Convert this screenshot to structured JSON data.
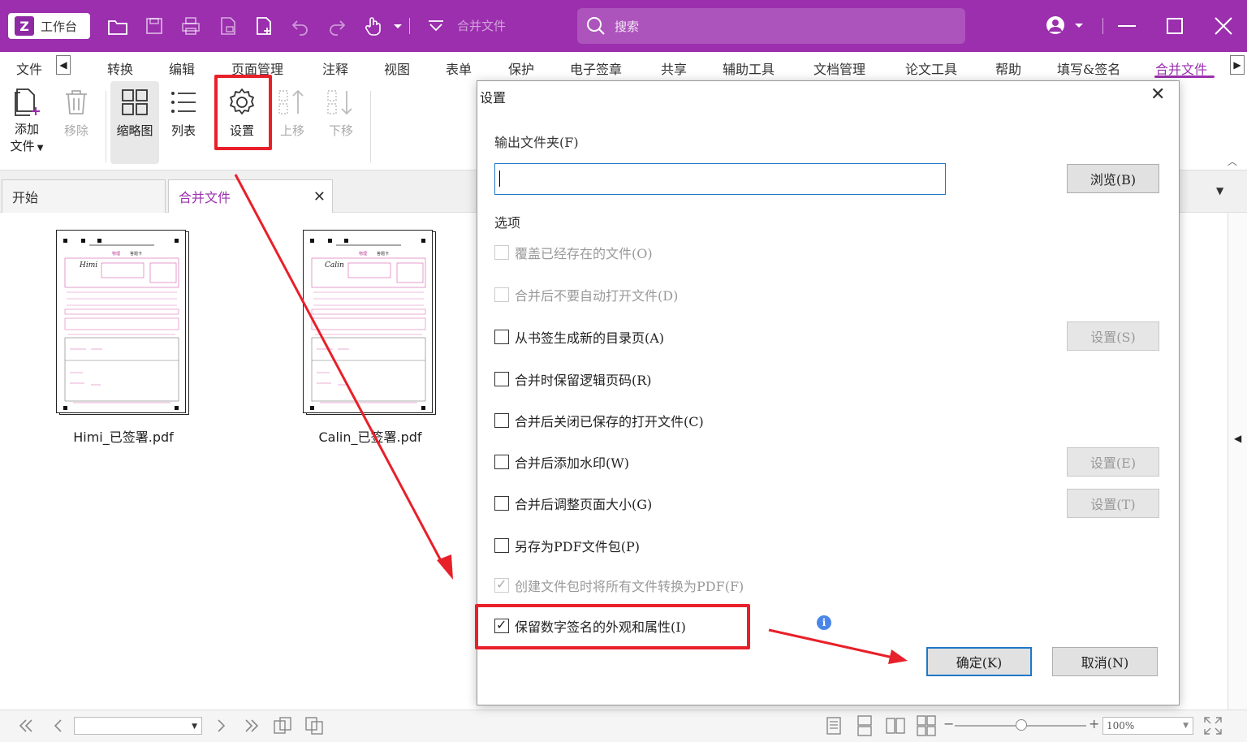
{
  "titlebar": {
    "home_label": "工作台",
    "doc_title": "合并文件",
    "search_placeholder": "搜索"
  },
  "menu": {
    "items": [
      "文件",
      "转换",
      "编辑",
      "页面管理",
      "注释",
      "视图",
      "表单",
      "保护",
      "电子签章",
      "共享",
      "辅助工具",
      "文档管理",
      "论文工具",
      "帮助",
      "填写&签名",
      "合并文件"
    ],
    "active": "合并文件"
  },
  "ribbon": {
    "add_file": "添加",
    "add_file_2": "文件",
    "remove": "移除",
    "thumbnail": "缩略图",
    "list": "列表",
    "settings": "设置",
    "move_up": "上移",
    "move_down": "下移"
  },
  "tabs": {
    "start": "开始",
    "merge": "合并文件"
  },
  "files": [
    {
      "name": "Himi_已签署.pdf",
      "signature": "Himi"
    },
    {
      "name": "Calin_已签署.pdf",
      "signature": "Calin"
    }
  ],
  "statusbar": {
    "zoom": "100%"
  },
  "dialog": {
    "title": "设置",
    "output_folder_label": "输出文件夹(F)",
    "output_folder_value": "",
    "browse": "浏览(B)",
    "options_label": "选项",
    "options": [
      {
        "label": "覆盖已经存在的文件(O)",
        "checked": false,
        "disabled": true
      },
      {
        "label": "合并后不要自动打开文件(D)",
        "checked": false,
        "disabled": true
      },
      {
        "label": "从书签生成新的目录页(A)",
        "checked": false,
        "disabled": false
      },
      {
        "label": "合并时保留逻辑页码(R)",
        "checked": false,
        "disabled": false
      },
      {
        "label": "合并后关闭已保存的打开文件(C)",
        "checked": false,
        "disabled": false
      },
      {
        "label": "合并后添加水印(W)",
        "checked": false,
        "disabled": false
      },
      {
        "label": "合并后调整页面大小(G)",
        "checked": false,
        "disabled": false
      },
      {
        "label": "另存为PDF文件包(P)",
        "checked": false,
        "disabled": false
      },
      {
        "label": "创建文件包时将所有文件转换为PDF(F)",
        "checked": true,
        "disabled": true
      },
      {
        "label": "保留数字签名的外观和属性(I)",
        "checked": true,
        "disabled": false
      }
    ],
    "setting_s": "设置(S)",
    "setting_e": "设置(E)",
    "setting_t": "设置(T)",
    "ok": "确定(K)",
    "cancel": "取消(N)"
  },
  "colors": {
    "brand": "#9b2fae",
    "highlight": "#e8202a",
    "focus": "#1e78c8"
  }
}
